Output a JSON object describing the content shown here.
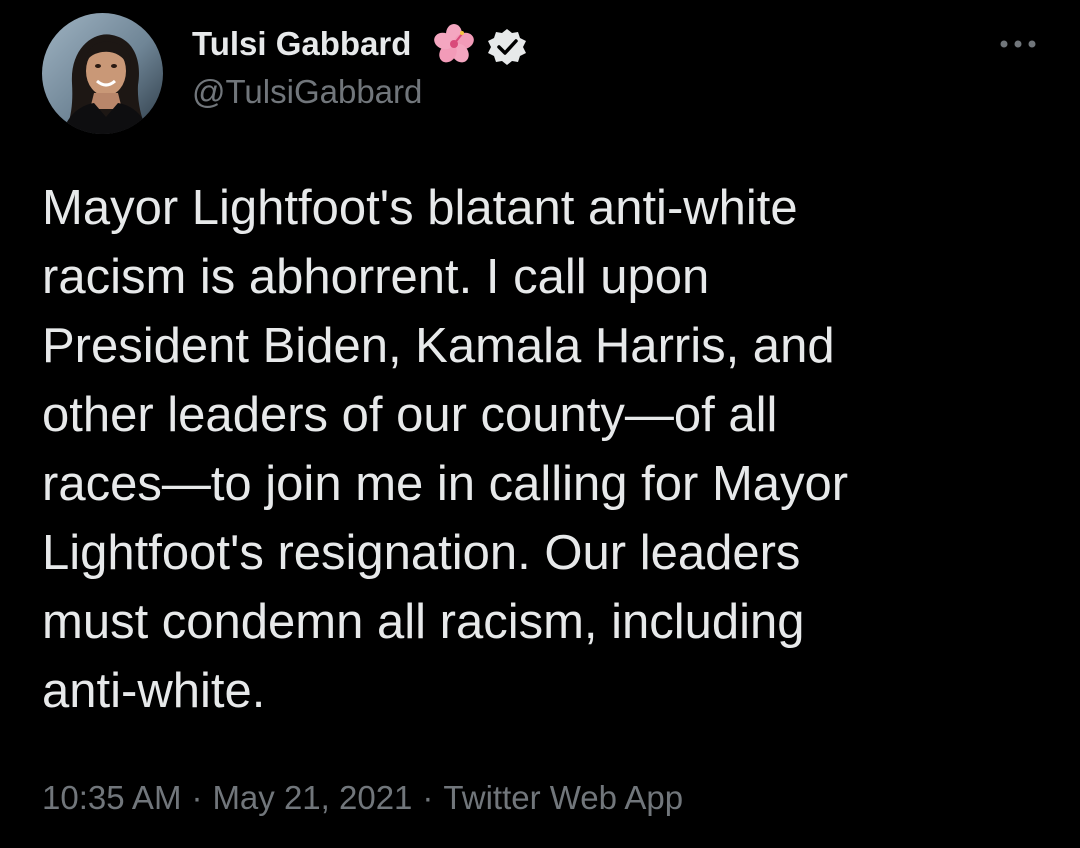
{
  "author": {
    "name": "Tulsi Gabbard",
    "handle": "@TulsiGabbard",
    "avatar_icon": "profile-photo",
    "badge_icons": [
      "hibiscus-flower-icon",
      "verified-badge-icon"
    ]
  },
  "menu": {
    "icon": "more-options-icon"
  },
  "tweet": {
    "lines": [
      "Mayor Lightfoot's blatant anti-white",
      "racism is abhorrent. I call upon",
      "President Biden, Kamala Harris, and",
      "other leaders of our county—of all",
      "races—to join me in calling for Mayor",
      "Lightfoot's resignation. Our leaders",
      "must condemn all racism, including",
      "anti-white."
    ]
  },
  "meta": {
    "time": "10:35 AM",
    "separator": "·",
    "date": "May 21, 2021",
    "source": "Twitter Web App"
  },
  "colors": {
    "background": "#000000",
    "text_primary": "#e7e9ea",
    "text_secondary": "#71767b"
  }
}
